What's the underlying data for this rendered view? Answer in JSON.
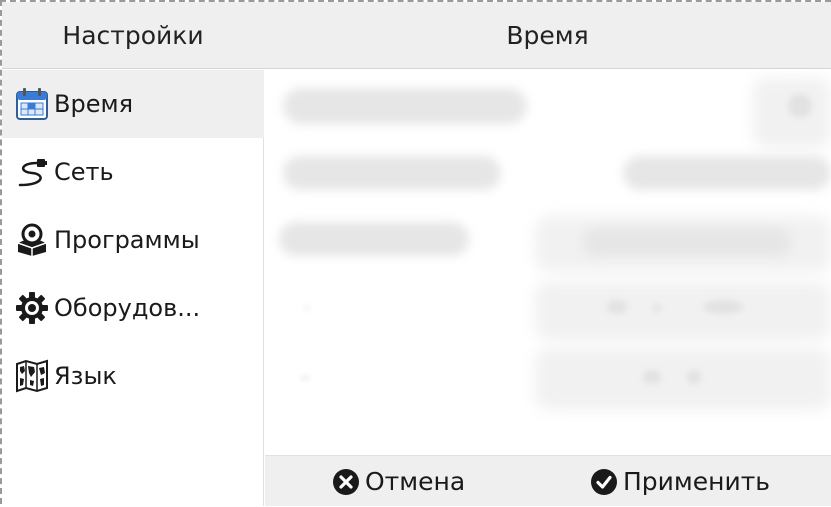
{
  "header": {
    "left_title": "Настройки",
    "page_title": "Время"
  },
  "sidebar": {
    "items": [
      {
        "label": "Время",
        "icon": "calendar-icon",
        "selected": true
      },
      {
        "label": "Сеть",
        "icon": "network-cable-icon",
        "selected": false
      },
      {
        "label": "Программы",
        "icon": "software-package-icon",
        "selected": false
      },
      {
        "label": "Оборудов...",
        "icon": "gear-icon",
        "selected": false
      },
      {
        "label": "Язык",
        "icon": "world-map-icon",
        "selected": false
      }
    ]
  },
  "footer": {
    "cancel_label": "Отмена",
    "cancel_icon": "cancel-circle-icon",
    "apply_label": "Применить",
    "apply_icon": "check-circle-icon"
  },
  "colors": {
    "header_bg": "#efefef",
    "selected_bg": "#efefef",
    "calendar_blue": "#3a7bd5",
    "icon_dark": "#1a1a1a"
  }
}
